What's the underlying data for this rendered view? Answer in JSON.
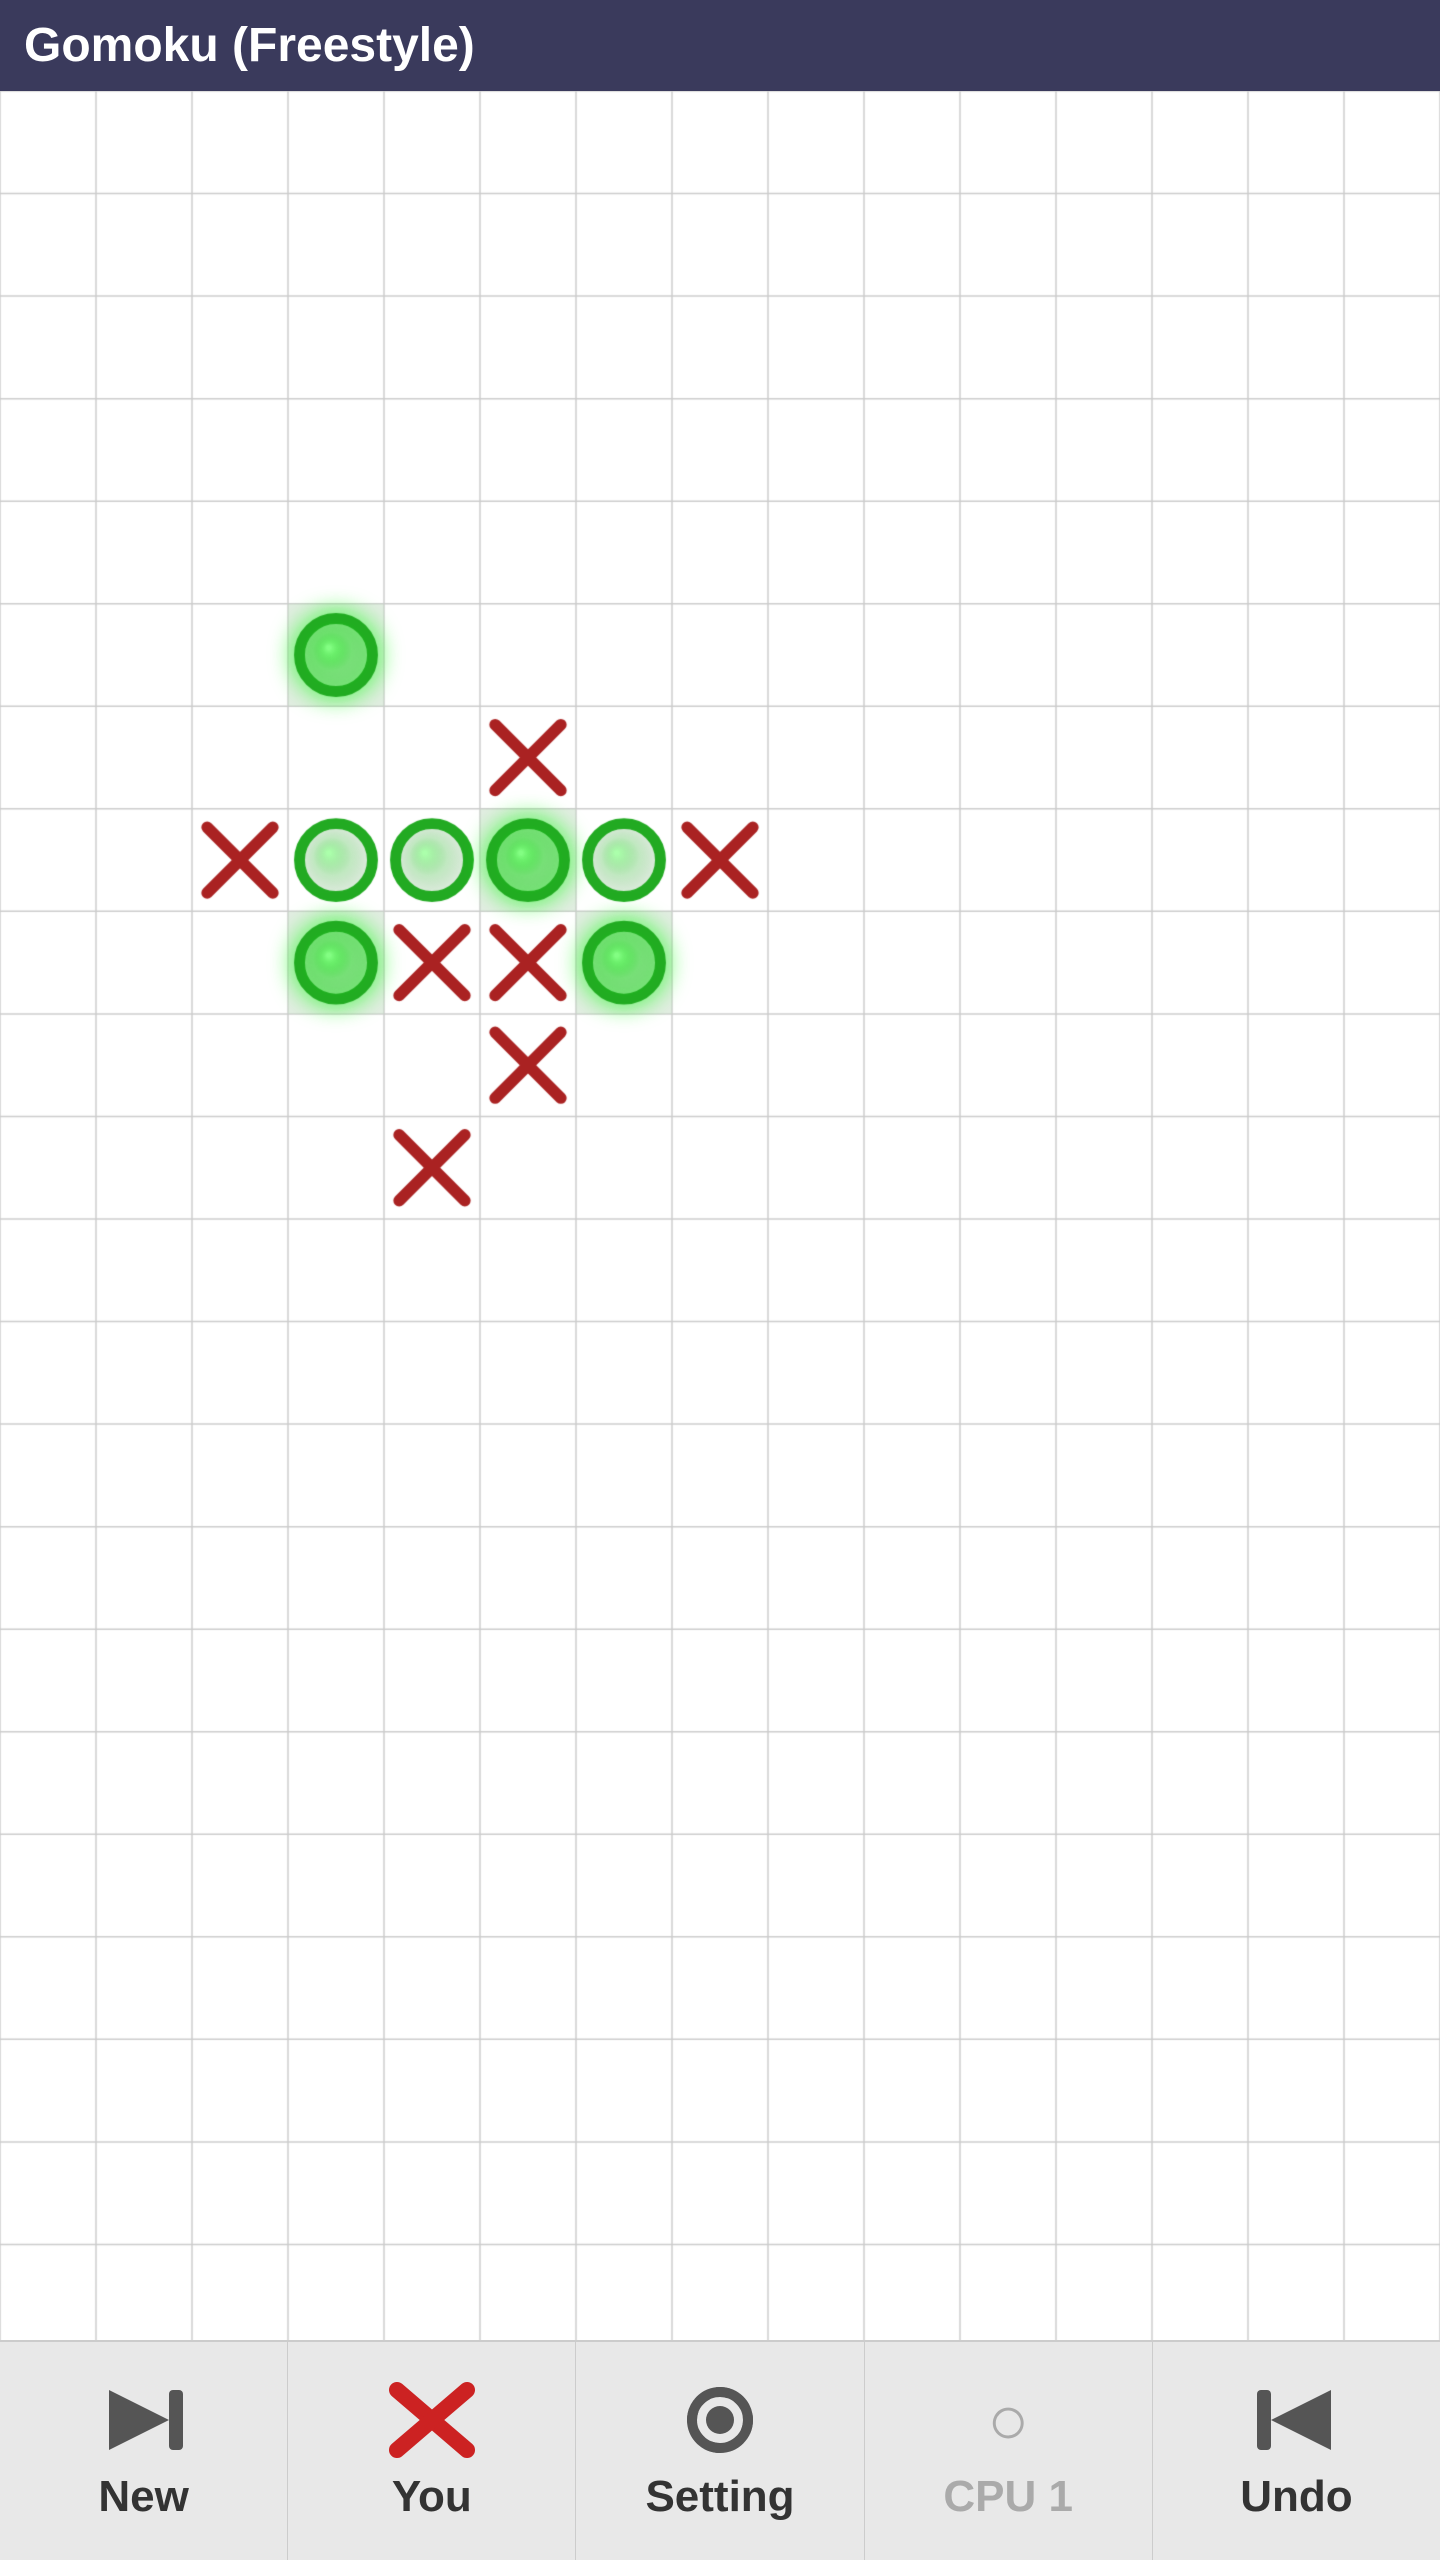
{
  "title": "Gomoku (Freestyle)",
  "grid": {
    "cols": 15,
    "rows": 22,
    "cell_size": 95
  },
  "pieces": [
    {
      "type": "O",
      "col": 3,
      "row": 5,
      "highlight": true
    },
    {
      "type": "X",
      "col": 5,
      "row": 6
    },
    {
      "type": "X",
      "col": 2,
      "row": 7
    },
    {
      "type": "O",
      "col": 3,
      "row": 7
    },
    {
      "type": "O",
      "col": 4,
      "row": 7
    },
    {
      "type": "O",
      "col": 5,
      "row": 7,
      "highlight": true
    },
    {
      "type": "O",
      "col": 6,
      "row": 7
    },
    {
      "type": "X",
      "col": 7,
      "row": 7
    },
    {
      "type": "O",
      "col": 3,
      "row": 8,
      "highlight": true
    },
    {
      "type": "X",
      "col": 4,
      "row": 8
    },
    {
      "type": "X",
      "col": 5,
      "row": 8
    },
    {
      "type": "O",
      "col": 6,
      "row": 8,
      "highlight": true
    },
    {
      "type": "X",
      "col": 5,
      "row": 9
    },
    {
      "type": "X",
      "col": 4,
      "row": 10
    }
  ],
  "bottom_bar": {
    "buttons": [
      {
        "id": "new",
        "label": "New",
        "icon": "arrow-forward"
      },
      {
        "id": "you",
        "label": "You",
        "icon": "x-mark"
      },
      {
        "id": "setting",
        "label": "Setting",
        "icon": "gear"
      },
      {
        "id": "cpu1",
        "label": "CPU 1",
        "icon": "cpu",
        "disabled": true
      },
      {
        "id": "undo",
        "label": "Undo",
        "icon": "arrow-back"
      }
    ]
  }
}
